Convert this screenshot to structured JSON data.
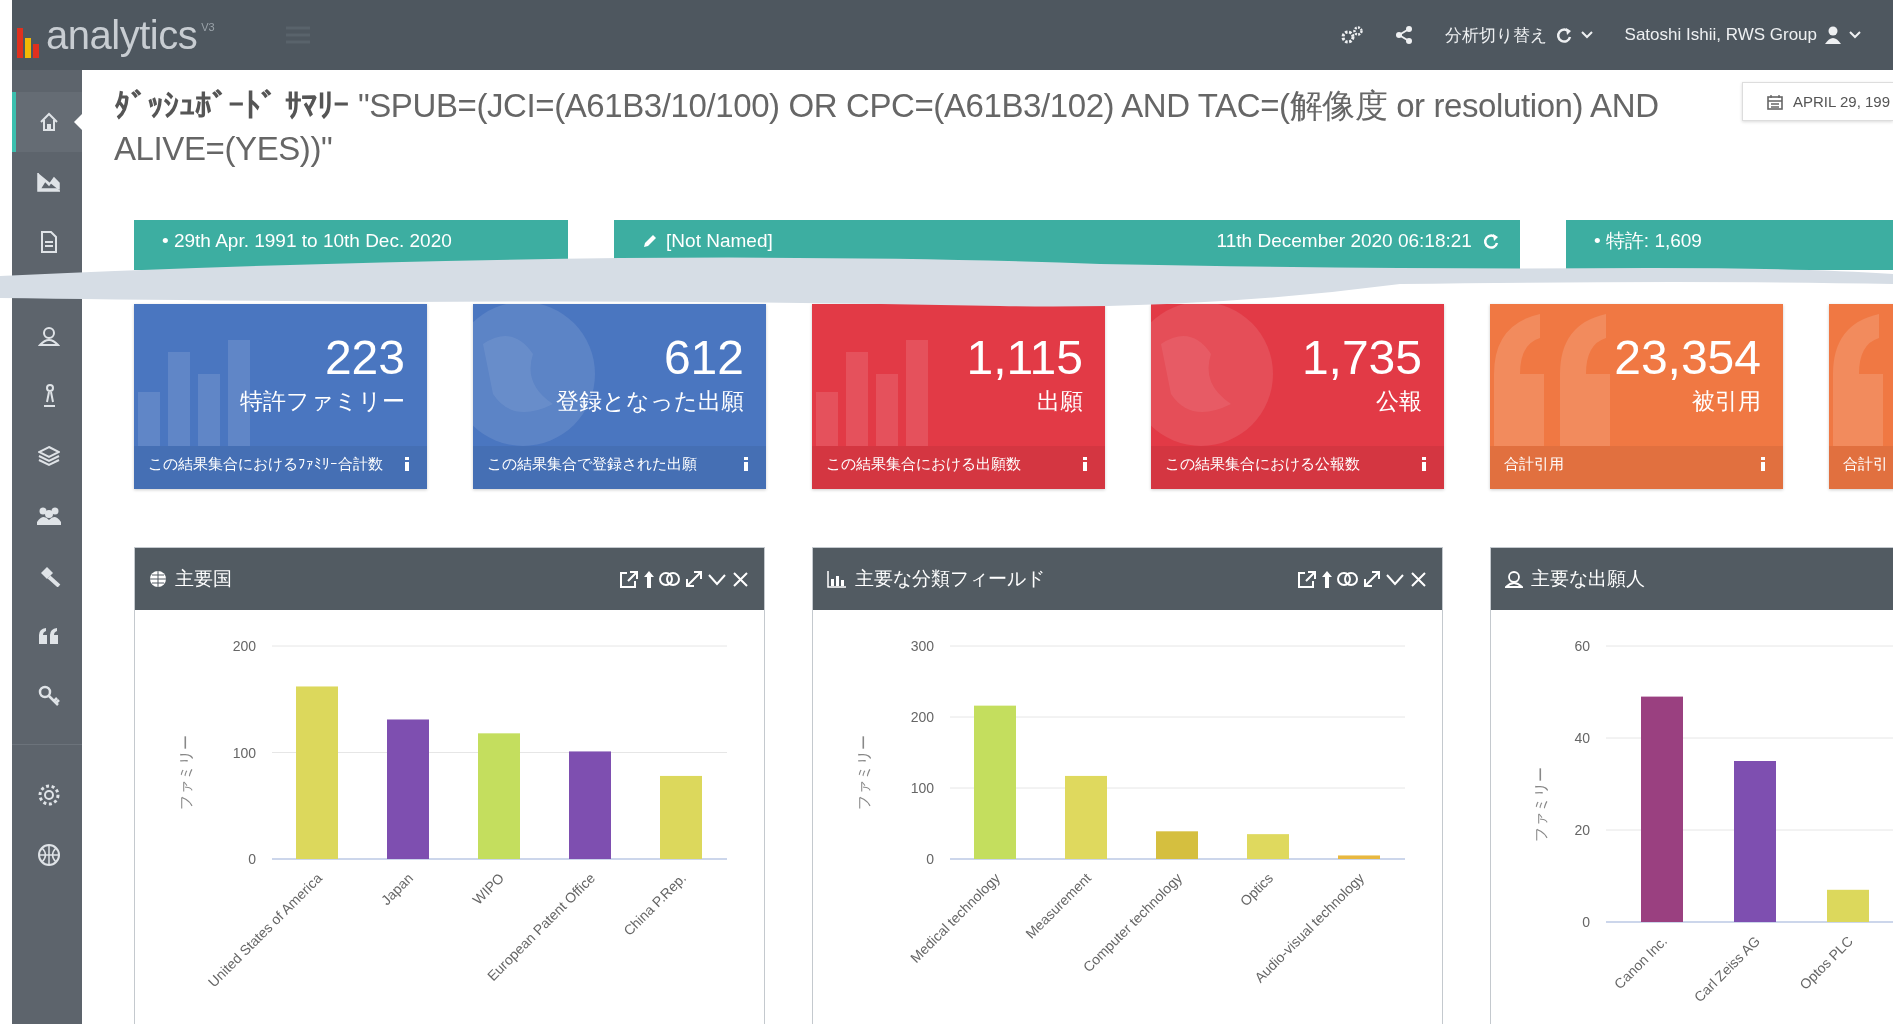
{
  "topbar": {
    "logo": "analytics",
    "version": "V3",
    "switch_label": "分析切り替え",
    "user": "Satoshi Ishii, RWS Group"
  },
  "sidebar": {
    "groups": [
      {
        "items": [
          {
            "selected": true
          },
          {
            "selected": false
          },
          {
            "selected": false
          },
          {
            "selected": false
          },
          {
            "selected": false
          },
          {
            "selected": false
          },
          {
            "selected": false
          },
          {
            "selected": false
          },
          {
            "selected": false
          },
          {
            "selected": false
          }
        ]
      },
      {
        "items": [
          {
            "selected": false
          },
          {
            "selected": false
          }
        ]
      }
    ]
  },
  "title": "**ﾀﾞｯｼｭﾎﾞｰﾄﾞ ｻﾏﾘｰ** \"SPUB=(JCI=(A61B3/10/100) OR CPC=(A61B3/102) AND TAC=(解像度 or resolution) AND ALIVE=(YES))\"",
  "date_button": "APRIL 29, 199",
  "info_bars": [
    {
      "kind": "range",
      "text": "•  29th Apr. 1991 to 10th Dec. 2020"
    },
    {
      "kind": "search",
      "text": "[Not Named]",
      "timestamp": "11th December 2020 06:18:21"
    },
    {
      "kind": "range",
      "text": "•  特許: 1,609"
    }
  ],
  "cards": [
    {
      "value": "223",
      "label": "特許ファミリー",
      "footer": "この結果集合におけるﾌｧﾐﾘｰ合計数",
      "color": "#4a76c0",
      "kind": "bars"
    },
    {
      "value": "612",
      "label": "登録となった出願",
      "footer": "この結果集合で登録された出願",
      "color": "#4a76c0",
      "kind": "globe"
    },
    {
      "value": "1,115",
      "label": "出願",
      "footer": "この結果集合における出願数",
      "color": "#e23a46",
      "kind": "bars"
    },
    {
      "value": "1,735",
      "label": "公報",
      "footer": "この結果集合における公報数",
      "color": "#e23a46",
      "kind": "globe"
    },
    {
      "value": "23,354",
      "label": "被引用",
      "footer": "合計引用",
      "color": "#f07843",
      "kind": "quote"
    },
    {
      "footer": "合計引",
      "color": "#f07843",
      "kind": "quote"
    }
  ],
  "panels": [
    {
      "kind": "globe",
      "title": "主要国",
      "toolbar": true,
      "chart_data": {
        "type": "bar",
        "ylabel": "ファミリー",
        "categories": [
          "United States of America",
          "Japan",
          "WIPO",
          "European Patent Office",
          "China P.Rep."
        ],
        "ylim": [
          0,
          200
        ],
        "yticks": [
          0,
          100,
          200
        ],
        "series": [
          {
            "values": [
              162,
              131,
              118,
              101,
              78
            ]
          }
        ]
      }
    },
    {
      "kind": "chart",
      "title": "主要な分類フィールド",
      "toolbar": true,
      "chart_data": {
        "type": "bar",
        "ylabel": "ファミリー",
        "categories": [
          "Medical technology",
          "Measurement",
          "Computer technology",
          "Optics",
          "Audio-visual technology"
        ],
        "ylim": [
          0,
          300
        ],
        "yticks": [
          0,
          100,
          200,
          300
        ],
        "series": [
          {
            "values": [
              216,
              117,
              39,
              35,
              5
            ]
          }
        ]
      }
    },
    {
      "kind": "person",
      "title": "主要な出願人",
      "chart_data": {
        "type": "bar",
        "ylabel": "ファミリー",
        "categories": [
          "Canon Inc.",
          "Carl Zeiss AG",
          "Optos PLC"
        ],
        "ylim": [
          0,
          60
        ],
        "yticks": [
          0,
          20,
          40,
          60
        ],
        "series": [
          {
            "values": [
              49,
              35,
              7
            ]
          }
        ]
      }
    }
  ]
}
